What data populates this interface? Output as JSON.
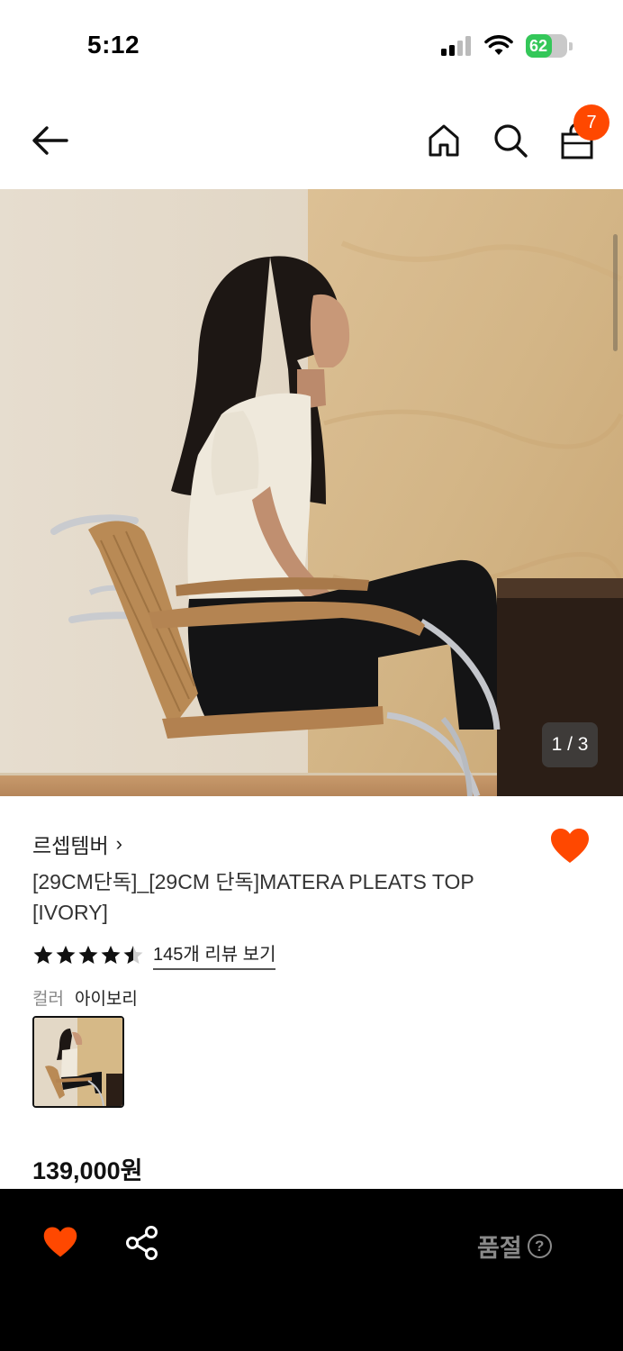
{
  "status_bar": {
    "time": "5:12",
    "battery_percent": "62",
    "battery_level": 0.62
  },
  "header": {
    "back_icon": "arrow-left-icon",
    "home_icon": "home-icon",
    "search_icon": "search-icon",
    "bag_icon": "shopping-bag-icon",
    "cart_count": "7",
    "badge_color": "#ff4800"
  },
  "gallery": {
    "counter": "1 / 3",
    "current_index": 1,
    "total": 3
  },
  "product": {
    "brand": "르셉템버",
    "brand_chevron": "›",
    "title": "[29CM단독]_[29CM 단독]MATERA PLEATS TOP [IVORY]",
    "rating": 4.5,
    "review_link": "145개 리뷰 보기",
    "color_label": "컬러",
    "color_value": "아이보리",
    "price": "139,000원",
    "liked": true,
    "heart_color": "#ff4800"
  },
  "bottom_bar": {
    "soldout_label": "품절",
    "help_glyph": "?"
  }
}
